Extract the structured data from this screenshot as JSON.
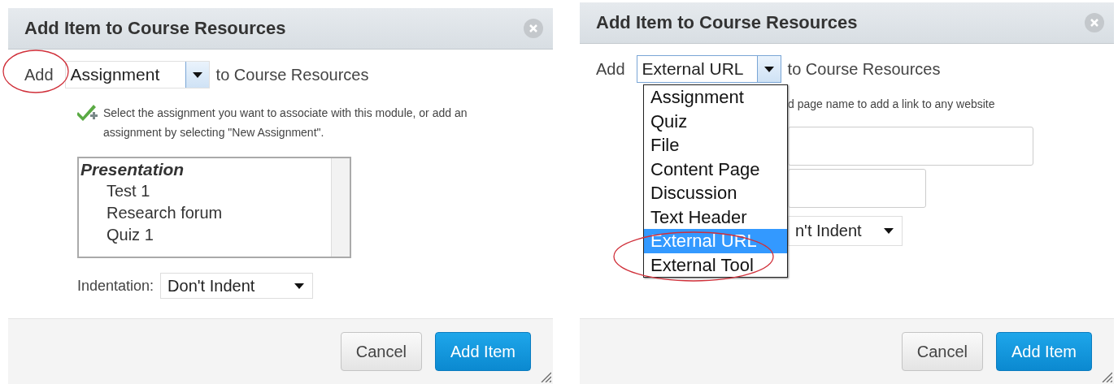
{
  "dialogs": [
    {
      "title": "Add Item to Course Resources",
      "add_label": "Add",
      "type_select": {
        "value": "Assignment",
        "focused": false
      },
      "suffix": "to Course Resources",
      "hint": "Select the assignment you want to associate with this module, or add an assignment by selecting \"New Assignment\".",
      "list": [
        {
          "label": "Presentation",
          "children": [
            {
              "label": "Test 1"
            },
            {
              "label": "Research forum"
            },
            {
              "label": "Quiz 1"
            }
          ]
        }
      ],
      "indent_label": "Indentation:",
      "indent_value": "Don't Indent",
      "buttons": [
        "Cancel",
        "Add Item"
      ]
    },
    {
      "title": "Add Item to Course Resources",
      "add_label": "Add",
      "type_select": {
        "value": "External URL",
        "focused": true
      },
      "suffix": "to Course Resources",
      "menu": [
        {
          "label": "Assignment",
          "selected": false
        },
        {
          "label": "Quiz",
          "selected": false
        },
        {
          "label": "File",
          "selected": false
        },
        {
          "label": "Content Page",
          "selected": false
        },
        {
          "label": "Discussion",
          "selected": false
        },
        {
          "label": "Text Header",
          "selected": false
        },
        {
          "label": "External URL",
          "selected": true
        },
        {
          "label": "External Tool",
          "selected": false
        }
      ],
      "hint": "d page name to add a link to any website",
      "fields": [
        {
          "kind": "wide"
        },
        {
          "kind": "narrow"
        }
      ],
      "indent_value": "n't Indent",
      "buttons": [
        "Cancel",
        "Add Item"
      ]
    }
  ]
}
